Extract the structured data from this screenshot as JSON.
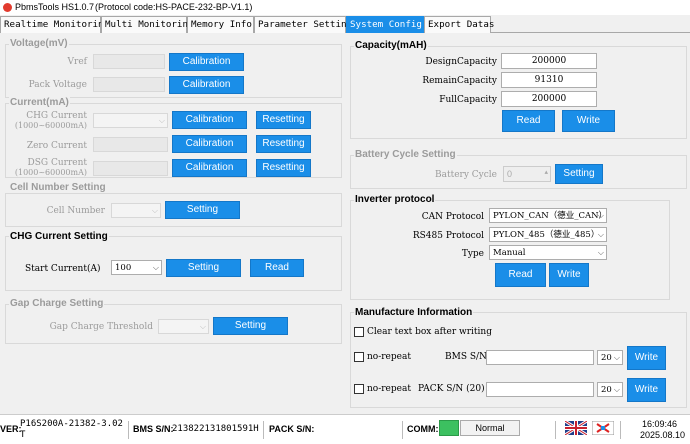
{
  "app": {
    "title": "PbmsTools HS1.0.7",
    "protocol": "(Protocol code:HS-PACE-232-BP-V1.1)"
  },
  "tabs": [
    "Realtime Monitoring",
    "Multi Monitoring",
    "Memory Info.",
    "Parameter Setting",
    "System Config.",
    "Export Datas"
  ],
  "active_tab": "System Config.",
  "voltage": {
    "title": "Voltage(mV)",
    "vref": "Vref",
    "pack": "Pack Voltage",
    "cal": "Calibration"
  },
  "current": {
    "title": "Current(mA)",
    "chg": "CHG Current",
    "chg_range": "(1000~60000mA)",
    "zero": "Zero Current",
    "dsg": "DSG Current",
    "dsg_range": "(1000~60000mA)",
    "cal": "Calibration",
    "reset": "Resetting"
  },
  "cellnum": {
    "title": "Cell Number Setting",
    "label": "Cell Number",
    "setting": "Setting"
  },
  "chg_setting": {
    "title": "CHG Current Setting",
    "label": "Start Current(A)",
    "value": "100",
    "setting": "Setting",
    "read": "Read"
  },
  "gap": {
    "title": "Gap Charge Setting",
    "label": "Gap Charge Threshold",
    "setting": "Setting"
  },
  "capacity": {
    "title": "Capacity(mAH)",
    "design_label": "DesignCapacity",
    "design": "200000",
    "remain_label": "RemainCapacity",
    "remain": "91310",
    "full_label": "FullCapacity",
    "full": "200000",
    "read": "Read",
    "write": "Write"
  },
  "cycle": {
    "title": "Battery Cycle Setting",
    "label": "Battery Cycle",
    "value": "0",
    "setting": "Setting"
  },
  "inverter": {
    "title": "Inverter protocol",
    "can_label": "CAN Protocol",
    "can": "PYLON_CAN（德业_CAN）",
    "rs485_label": "RS485 Protocol",
    "rs485": "PYLON_485（德业_485）",
    "type_label": "Type",
    "type": "Manual",
    "read": "Read",
    "write": "Write"
  },
  "manufacture": {
    "title": "Manufacture Information",
    "clear": "Clear text box after writing",
    "norepeat1": "no-repeat",
    "bms_label": "BMS S/N",
    "bms_len": "20",
    "write1": "Write",
    "norepeat2": "no-repeat",
    "pack_label": "PACK S/N (20)",
    "pack_len": "20",
    "write2": "Write"
  },
  "status": {
    "ver_label": "VER:",
    "ver1": "P16S200A-21382-3.02",
    "ver2": "T",
    "bms_label": "BMS S/N:",
    "bms_sn": "213822131801591H",
    "pack_label": "PACK S/N:",
    "comm_label": "COMM:",
    "comm": "Normal",
    "time": "16:09:46",
    "date": "2025.08.10"
  },
  "colors": {
    "accent": "#1a8ee8",
    "comm_ok": "#3cc060"
  }
}
